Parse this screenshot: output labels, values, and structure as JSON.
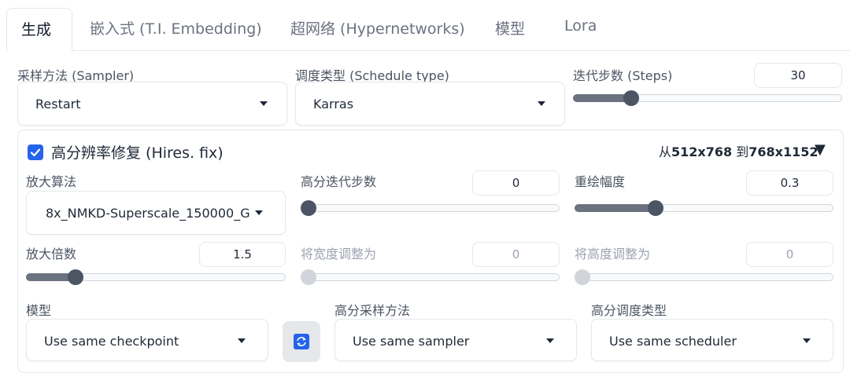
{
  "tabs": [
    {
      "label": "生成"
    },
    {
      "label": "嵌入式 (T.I. Embedding)"
    },
    {
      "label": "超网络 (Hypernetworks)"
    },
    {
      "label": "模型"
    },
    {
      "label": "Lora"
    }
  ],
  "sampler": {
    "label": "采样方法 (Sampler)",
    "value": "Restart"
  },
  "schedule": {
    "label": "调度类型 (Schedule type)",
    "value": "Karras"
  },
  "steps": {
    "label": "迭代步数 (Steps)",
    "value": "30",
    "level": 0.2
  },
  "hires": {
    "checked": true,
    "label": "高分辨率修复 (Hires. fix)",
    "size_from_prefix": "从",
    "size_from": "512x768",
    "size_to_prefix": "到",
    "size_to": "768x1152",
    "collapse_glyph": "▼",
    "upscaler": {
      "label": "放大算法",
      "value": "8x_NMKD-Superscale_150000_G"
    },
    "hires_steps": {
      "label": "高分迭代步数",
      "value": "0",
      "level": 0.0
    },
    "denoise": {
      "label": "重绘幅度",
      "value": "0.3",
      "level": 0.3
    },
    "scale": {
      "label": "放大倍数",
      "value": "1.5",
      "level": 0.17
    },
    "resize_width": {
      "label": "将宽度调整为",
      "value": "0",
      "level": 0.0
    },
    "resize_height": {
      "label": "将高度调整为",
      "value": "0",
      "level": 0.0
    },
    "checkpoint": {
      "label": "模型",
      "value": "Use same checkpoint"
    },
    "hires_sampler": {
      "label": "高分采样方法",
      "value": "Use same sampler"
    },
    "hires_scheduler": {
      "label": "高分调度类型",
      "value": "Use same scheduler"
    }
  },
  "colors": {
    "accent": "#2563eb",
    "slider_fill": "#6b7280"
  }
}
